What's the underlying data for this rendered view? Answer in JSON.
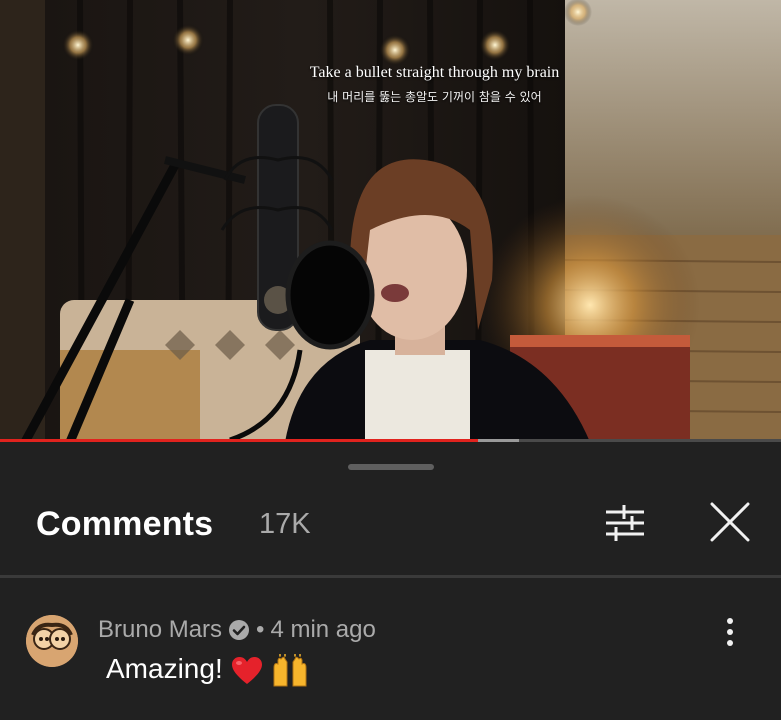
{
  "video": {
    "lyric_line_en": "Take a bullet straight through my brain",
    "lyric_line_ko": "내 머리를 뚫는 총알도 기꺼이 참을 수 있어",
    "progress_played": 0.612,
    "progress_buffered": 0.665
  },
  "comments_panel": {
    "title": "Comments",
    "count": "17K",
    "icons": {
      "filter": "sort-sliders-icon",
      "close": "close-icon"
    }
  },
  "comment": {
    "author": "Bruno Mars",
    "separator": "•",
    "time": "4 min ago",
    "text": "Amazing!",
    "emojis": [
      "red-heart",
      "raising-hands"
    ],
    "icons": {
      "verified": "verified-check-icon",
      "more": "more-vert-icon"
    }
  },
  "colors": {
    "background": "#212121",
    "progress_played": "#e1231e",
    "secondary_text": "#aaaaaa"
  }
}
